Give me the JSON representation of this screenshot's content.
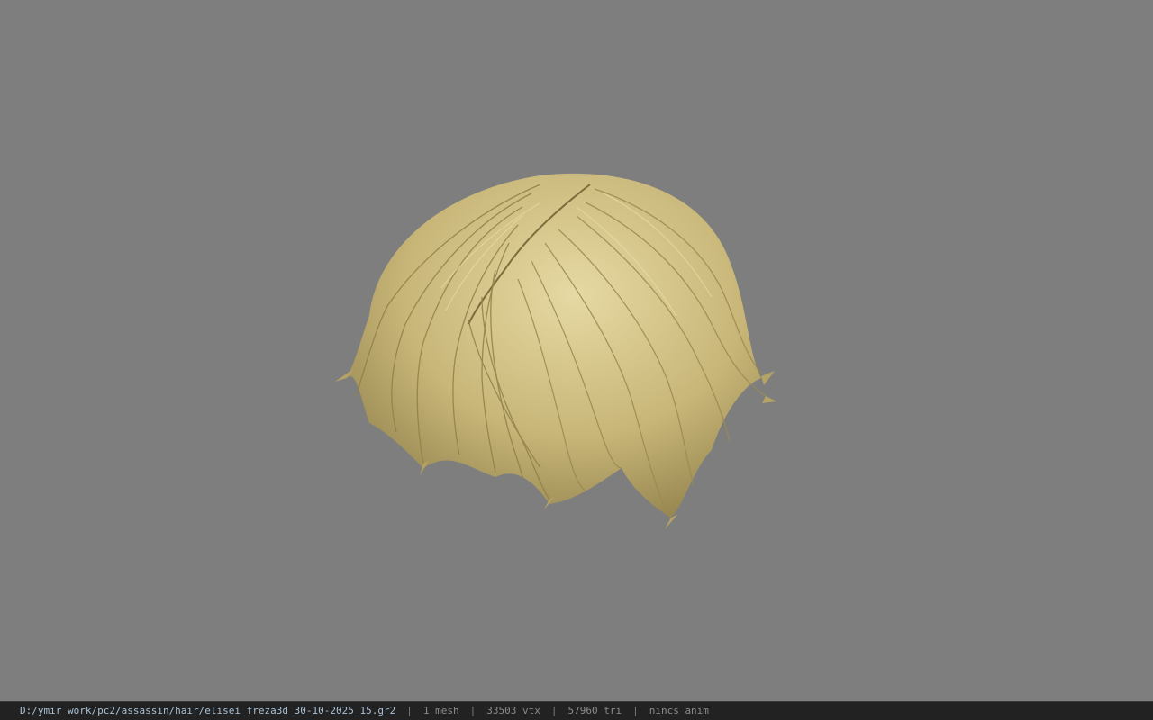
{
  "viewport": {
    "background_color": "#7e7e7e",
    "model": {
      "kind": "hair mesh",
      "base_color": "#c8b678",
      "highlight_color": "#e6d9a3",
      "shadow_color": "#8c7c47"
    }
  },
  "status_bar": {
    "file_path": "D:/ymir work/pc2/assassin/hair/elisei_freza3d_30-10-2025_15.gr2",
    "separator": "|",
    "mesh_count": "1 mesh",
    "vertex_count": "33503 vtx",
    "triangle_count": "57960 tri",
    "anim_status": "nincs anim"
  }
}
